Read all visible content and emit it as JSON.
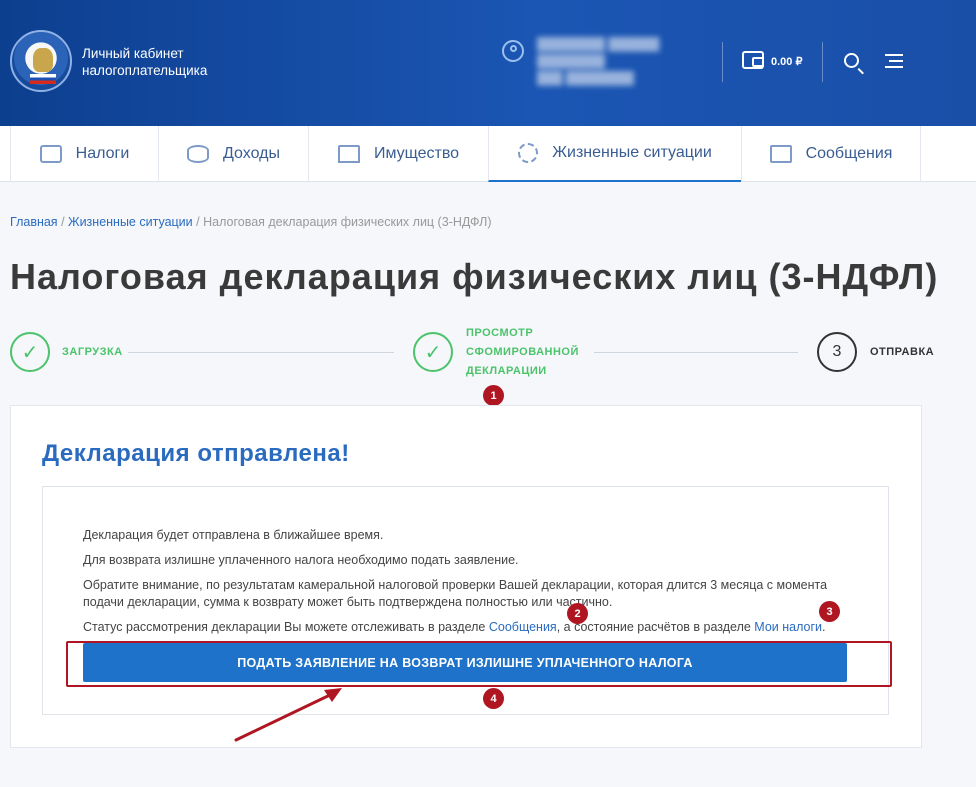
{
  "header": {
    "brand_line1": "Личный кабинет",
    "brand_line2": "налогоплательщика",
    "balance": "0.00 ₽"
  },
  "nav": {
    "items": [
      {
        "label": "Налоги"
      },
      {
        "label": "Доходы"
      },
      {
        "label": "Имущество"
      },
      {
        "label": "Жизненные ситуации"
      },
      {
        "label": "Сообщения"
      }
    ]
  },
  "breadcrumb": {
    "home": "Главная",
    "section": "Жизненные ситуации",
    "current": "Налоговая декларация физических лиц (3-НДФЛ)",
    "separator": "/"
  },
  "page": {
    "title": "Налоговая декларация физических лиц (3-НДФЛ)"
  },
  "stepper": {
    "step1": "ЗАГРУЗКА",
    "step2_line1": "ПРОСМОТР",
    "step2_line2": "СФОМИРОВАННОЙ",
    "step2_line3": "ДЕКЛАРАЦИИ",
    "step3_number": "3",
    "step3": "ОТПРАВКА",
    "check": "✓"
  },
  "card": {
    "title": "Декларация отправлена!",
    "p1": "Декларация будет отправлена в ближайшее время.",
    "p2": "Для возврата излишне уплаченного налога необходимо подать заявление.",
    "p3_line1": "Обратите внимание, по результатам камеральной налоговой проверки Вашей декларации, которая длится 3 месяца с момента",
    "p3_line2": "подачи декларации, сумма к возврату может быть подтверждена полностью или частично.",
    "p4_prefix": "Статус рассмотрения декларации Вы можете отслеживать в разделе ",
    "p4_link1": "Сообщения",
    "p4_middle": ", а состояние расчётов в разделе ",
    "p4_link2": "Мои налоги",
    "p4_suffix": ".",
    "submit_label": "ПОДАТЬ ЗАЯВЛЕНИЕ НА ВОЗВРАТ ИЗЛИШНЕ УПЛАЧЕННОГО НАЛОГА"
  },
  "annotations": {
    "badge1": "1",
    "badge2": "2",
    "badge3": "3",
    "badge4": "4"
  },
  "colors": {
    "header": "#1b56b4",
    "accent": "#1f72c9",
    "success": "#4cc36b",
    "annotation": "#b01621"
  }
}
